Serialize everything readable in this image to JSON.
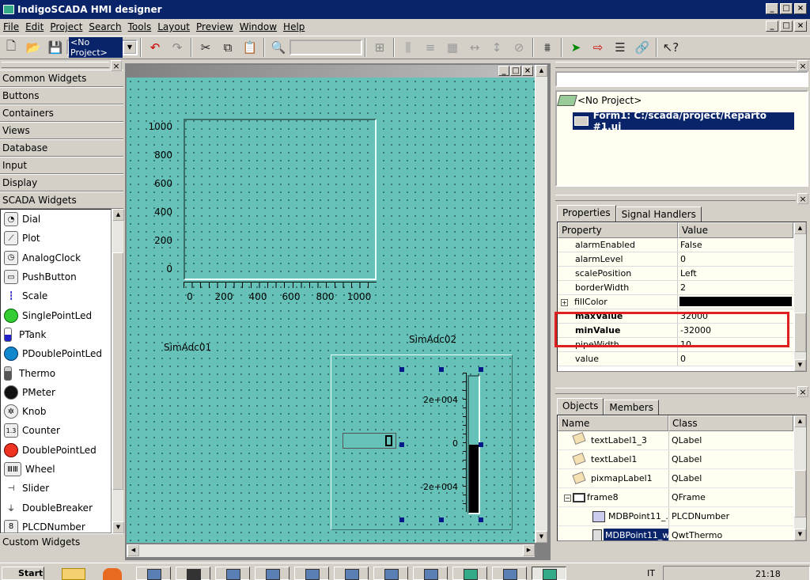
{
  "window": {
    "title": "IndigoSCADA HMI designer"
  },
  "menu": [
    "File",
    "Edit",
    "Project",
    "Search",
    "Tools",
    "Layout",
    "Preview",
    "Window",
    "Help"
  ],
  "toolbar": {
    "project_combo": "<No Project>"
  },
  "widget_panel": {
    "categories": [
      "Common Widgets",
      "Buttons",
      "Containers",
      "Views",
      "Database",
      "Input",
      "Display",
      "SCADA Widgets"
    ],
    "scada_widgets": [
      "Dial",
      "Plot",
      "AnalogClock",
      "PushButton",
      "Scale",
      "SinglePointLed",
      "PTank",
      "PDoublePointLed",
      "Thermo",
      "PMeter",
      "Knob",
      "Counter",
      "DoublePointLed",
      "Wheel",
      "Slider",
      "DoubleBreaker",
      "PLCDNumber"
    ],
    "footer": "Custom Widgets"
  },
  "canvas": {
    "plot_y_ticks": [
      "1000",
      "800",
      "600",
      "400",
      "200",
      "0"
    ],
    "plot_x_ticks": [
      "0",
      "200",
      "400",
      "600",
      "800",
      "1000"
    ],
    "label1": "SimAdc01",
    "label2": "SimAdc02",
    "thermo_ticks": [
      "2e+004",
      "0",
      "-2e+004"
    ],
    "thermo_fill_fraction": 0.5
  },
  "project_tree": {
    "root": "<No Project>",
    "form": "Form1: C:/scada/project/Reparto #1.ui"
  },
  "properties": {
    "tabs": [
      "Properties",
      "Signal Handlers"
    ],
    "headers": [
      "Property",
      "Value"
    ],
    "rows": [
      {
        "name": "alarmEnabled",
        "value": "False"
      },
      {
        "name": "alarmLevel",
        "value": "0"
      },
      {
        "name": "scalePosition",
        "value": "Left"
      },
      {
        "name": "borderWidth",
        "value": "2"
      },
      {
        "name": "fillColor",
        "value": ""
      },
      {
        "name": "maxValue",
        "value": "32000"
      },
      {
        "name": "minValue",
        "value": "-32000"
      },
      {
        "name": "pipeWidth",
        "value": "10"
      },
      {
        "name": "value",
        "value": "0"
      }
    ],
    "highlight_color": "#e02020"
  },
  "objects": {
    "tabs": [
      "Objects",
      "Members"
    ],
    "headers": [
      "Name",
      "Class"
    ],
    "rows": [
      {
        "name": "textLabel1_3",
        "class": "QLabel"
      },
      {
        "name": "textLabel1",
        "class": "QLabel"
      },
      {
        "name": "pixmapLabel1",
        "class": "QLabel"
      },
      {
        "name": "frame8",
        "class": "QFrame"
      },
      {
        "name": "MDBPoint11_...",
        "class": "PLCDNumber"
      },
      {
        "name": "MDBPoint11_w...",
        "class": "QwtThermo"
      }
    ]
  },
  "taskbar": {
    "start": "Start",
    "lang": "IT",
    "clock": "21:18"
  }
}
